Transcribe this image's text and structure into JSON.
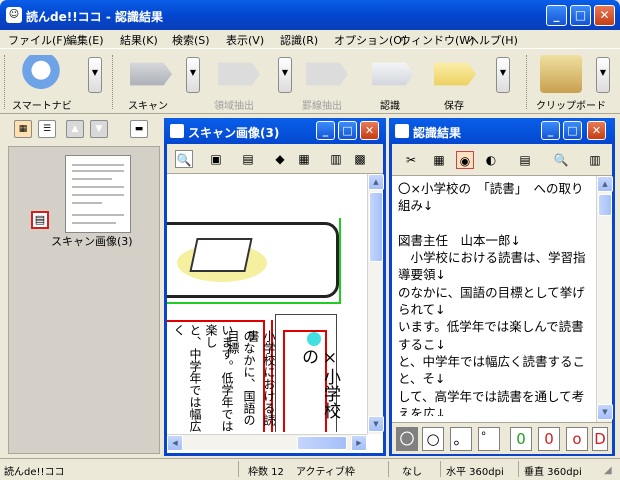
{
  "window": {
    "title": "読んde!!ココ - 認識結果",
    "app_icon": "document-icon"
  },
  "menu": [
    "ファイル(F)",
    "編集(E)",
    "結果(K)",
    "検索(S)",
    "表示(V)",
    "認識(R)",
    "オプション(O)",
    "ウィンドウ(W)",
    "ヘルプ(H)"
  ],
  "toolbar": {
    "navi": "スマートナビ",
    "scan": "スキャン",
    "area": "領域抽出",
    "ruler": "罫線抽出",
    "recog": "認識",
    "save": "保存",
    "clip": "クリップボード"
  },
  "left_panel": {
    "thumb_label": "スキャン画像(3)"
  },
  "scan_window": {
    "title": "スキャン画像(3)",
    "col1": "います。低学年では楽し",
    "col2": "と、中学年では幅広く",
    "col3": "小学校における読書",
    "col4": "のなかに、国語の目標",
    "col5": "×小学校の"
  },
  "result_window": {
    "title": "認識結果",
    "text": "〇×小学校の　「読書」　への取り組み↓\n\n図書主任　山本一郎↓\n　小学校における読書は、学習指導要領↓\nのなかに、国語の目標として挙げられて↓\nいます。低学年では楽しんで読書するこ↓\nと、中学年では幅広く読書すること、そ↓\nして、高学年では読書を通して考えを広↓",
    "chars": [
      "〇",
      "○",
      "。",
      "゜",
      "0",
      "0",
      "o",
      "D"
    ]
  },
  "status": {
    "app": "読んde!!ココ",
    "frames": "枠数 12",
    "active": "アクティブ枠",
    "none": "なし",
    "hdpi": "水平 360dpi",
    "vdpi": "垂直 360dpi"
  },
  "colors": {
    "titlebar": "#0347cf",
    "highlight_red": "#e00000",
    "frame_green": "#22cc22"
  }
}
